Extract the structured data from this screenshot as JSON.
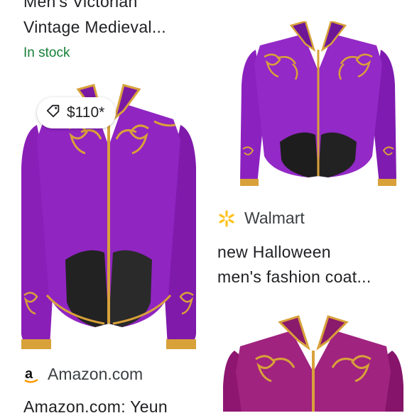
{
  "left_card_top": {
    "title_line1": "Men's Victorian",
    "title_line2": "Vintage Medieval...",
    "stock": "In stock"
  },
  "left_card": {
    "price": "$110*",
    "source": "Amazon.com",
    "title_line1": "Amazon.com: Yeun"
  },
  "right_card": {
    "source": "Walmart",
    "title_line1": "new Halloween",
    "title_line2": "men's fashion coat..."
  },
  "colors": {
    "jacket_purple": "#8a1fb8",
    "jacket_magenta": "#9c1c78",
    "gold": "#d8a13a",
    "stock_green": "#188038",
    "walmart_yellow": "#ffc220"
  },
  "icons": [
    "price-tag-icon",
    "amazon-logo-icon",
    "walmart-spark-icon"
  ]
}
